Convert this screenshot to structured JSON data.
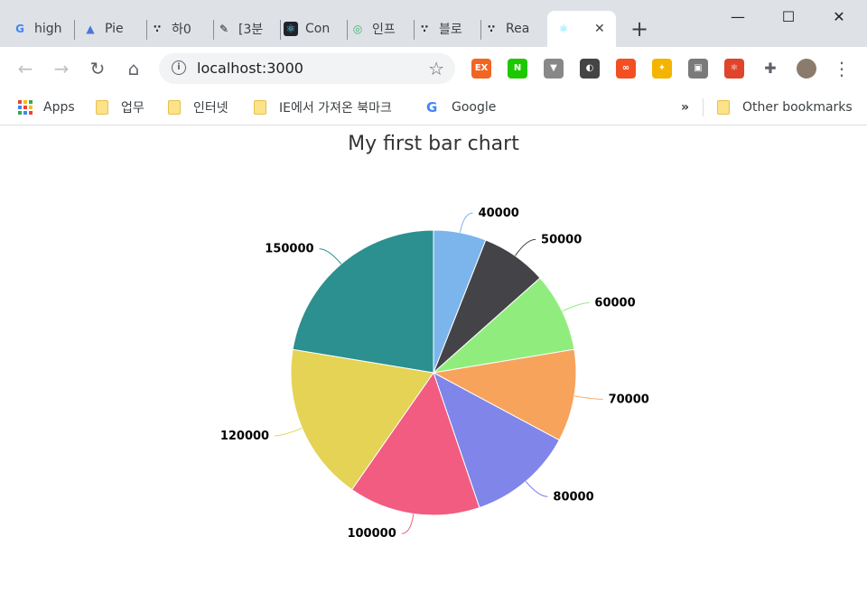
{
  "tabs": [
    {
      "title": "high",
      "icon": "google-icon",
      "color": "#4285f4"
    },
    {
      "title": "Pie",
      "icon": "triangle-icon",
      "color": "#4a76d8"
    },
    {
      "title": "하0",
      "icon": "dots-icon",
      "color": "#222222"
    },
    {
      "title": "[3분",
      "icon": "pen-icon",
      "color": "#222222"
    },
    {
      "title": "Con",
      "icon": "react-dark-icon",
      "color": "#20232a"
    },
    {
      "title": "인프",
      "icon": "inflearn-icon",
      "color": "#3cb46e"
    },
    {
      "title": "블로",
      "icon": "dots-icon",
      "color": "#222222"
    },
    {
      "title": "Rea",
      "icon": "dots-icon",
      "color": "#222222"
    },
    {
      "title": "",
      "icon": "react-icon",
      "color": "#61dafb",
      "active": true
    }
  ],
  "window_controls": {
    "minimize": "—",
    "maximize": "☐",
    "close": "✕"
  },
  "toolbar": {
    "back": "←",
    "forward": "→",
    "reload": "↻",
    "home": "⌂",
    "url": "localhost:3000",
    "star": "☆",
    "extensions": [
      {
        "name": "ex-extension-icon",
        "label": "EX",
        "color": "#f26522"
      },
      {
        "name": "naver-extension-icon",
        "label": "N",
        "color": "#1ec800"
      },
      {
        "name": "vue-extension-icon",
        "label": "▼",
        "color": "#888888"
      },
      {
        "name": "lightbulb-extension-icon",
        "label": "◐",
        "color": "#444444"
      },
      {
        "name": "infinity-extension-icon",
        "label": "∞",
        "color": "#f25022"
      },
      {
        "name": "box-extension-icon",
        "label": "✦",
        "color": "#f4b400"
      },
      {
        "name": "window-extension-icon",
        "label": "▣",
        "color": "#7a7a7a"
      },
      {
        "name": "react-devtools-extension-icon",
        "label": "⚛",
        "color": "#e0442a"
      },
      {
        "name": "puzzle-extension-icon",
        "label": "✚",
        "color": "#5f6368"
      }
    ],
    "menu": "⋮"
  },
  "bookmarks": {
    "items": [
      {
        "label": "Apps"
      },
      {
        "label": "업무"
      },
      {
        "label": "인터넷"
      },
      {
        "label": "IE에서 가져온 북마크"
      },
      {
        "label": "Google"
      }
    ],
    "more": "»",
    "other": "Other bookmarks"
  },
  "chart_data": {
    "type": "pie",
    "title": "My first bar chart",
    "values": [
      40000,
      50000,
      60000,
      70000,
      80000,
      100000,
      120000,
      150000
    ],
    "labels": [
      "40000",
      "50000",
      "60000",
      "70000",
      "80000",
      "100000",
      "120000",
      "150000"
    ],
    "colors": [
      "#7cb5ec",
      "#434348",
      "#90ed7d",
      "#f7a35c",
      "#8085e9",
      "#f15c80",
      "#e4d354",
      "#2b908f"
    ]
  }
}
